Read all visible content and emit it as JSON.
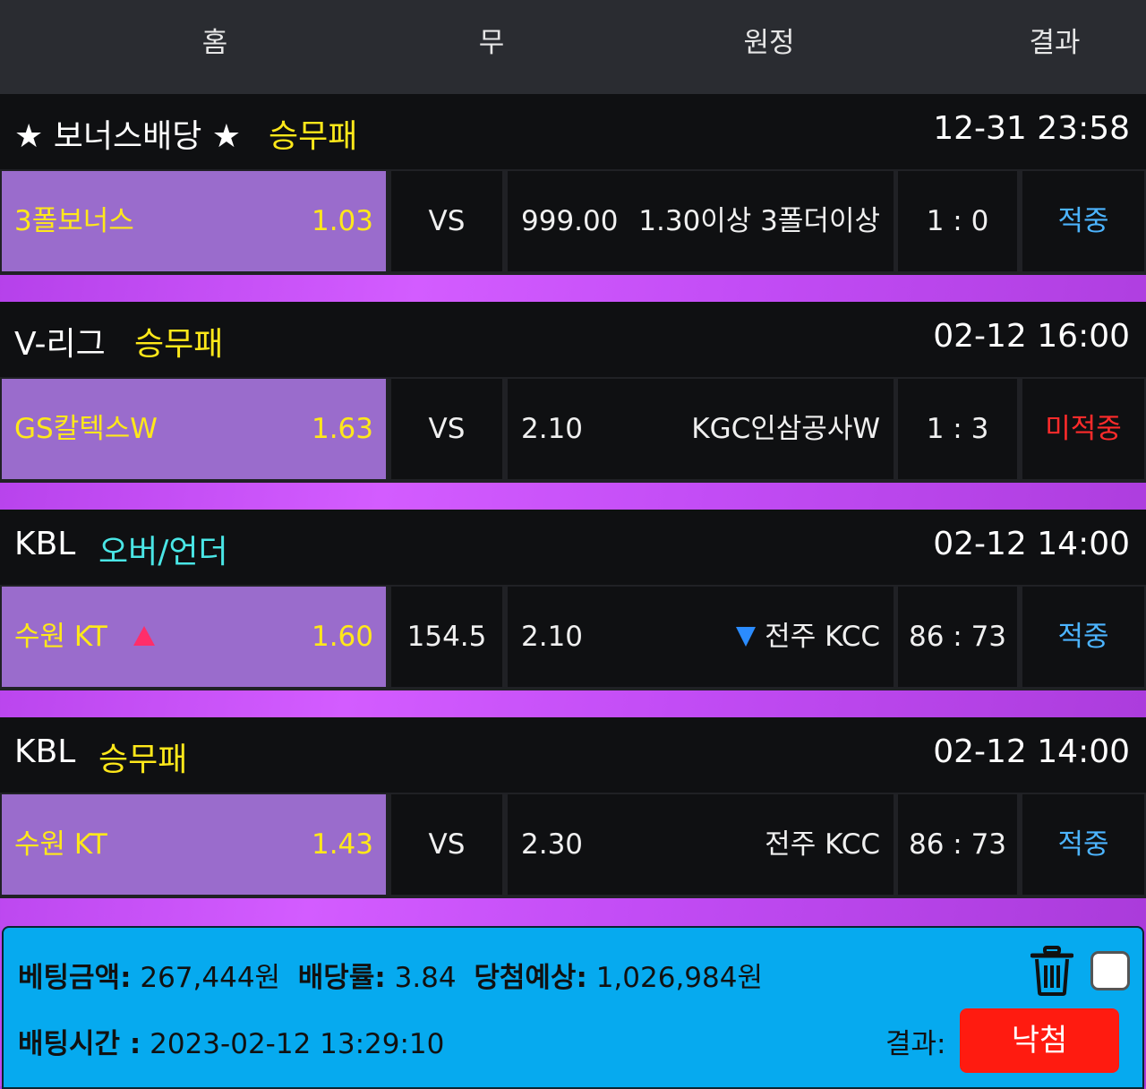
{
  "header": {
    "home": "홈",
    "draw": "무",
    "away": "원정",
    "result": "결과"
  },
  "groups": [
    {
      "league": "★ 보너스배당 ★",
      "type": "승무패",
      "time": "12-31 23:58",
      "home_team": "3폴보너스",
      "home_odds": "1.03",
      "draw": "VS",
      "away_odds": "999.00",
      "away_team": "1.30이상 3폴더이상",
      "score": "1 : 0",
      "result": "적중"
    },
    {
      "league": "V-리그",
      "type": "승무패",
      "time": "02-12 16:00",
      "home_team": "GS칼텍스W",
      "home_odds": "1.63",
      "draw": "VS",
      "away_odds": "2.10",
      "away_team": "KGC인삼공사W",
      "score": "1 : 3",
      "result": "미적중"
    },
    {
      "league": "KBL",
      "type": "오버/언더",
      "time": "02-12 14:00",
      "home_team": "수원 KT",
      "home_odds": "1.60",
      "draw": "154.5",
      "away_odds": "2.10",
      "away_team": "전주 KCC",
      "score": "86 : 73",
      "result": "적중"
    },
    {
      "league": "KBL",
      "type": "승무패",
      "time": "02-12 14:00",
      "home_team": "수원 KT",
      "home_odds": "1.43",
      "draw": "VS",
      "away_odds": "2.30",
      "away_team": "전주 KCC",
      "score": "86 : 73",
      "result": "적중"
    }
  ],
  "footer": {
    "bet_amount_label": "베팅금액:",
    "bet_amount": "267,444원",
    "odds_label": "배당률:",
    "odds": "3.84",
    "expected_label": "당첨예상:",
    "expected": "1,026,984원",
    "bet_time_label": "배팅시간 :",
    "bet_time": "2023-02-12 13:29:10",
    "result_label": "결과:",
    "result_button": "낙첨"
  },
  "colors": {
    "home_cell": "#9a6ccc",
    "footer": "#06aaef",
    "lose_button": "#ff1b10",
    "hit": "#4cb4ff",
    "miss": "#ff2b2b"
  },
  "icons": [
    "trash-icon",
    "checkbox",
    "up-triangle-icon",
    "down-triangle-icon"
  ]
}
